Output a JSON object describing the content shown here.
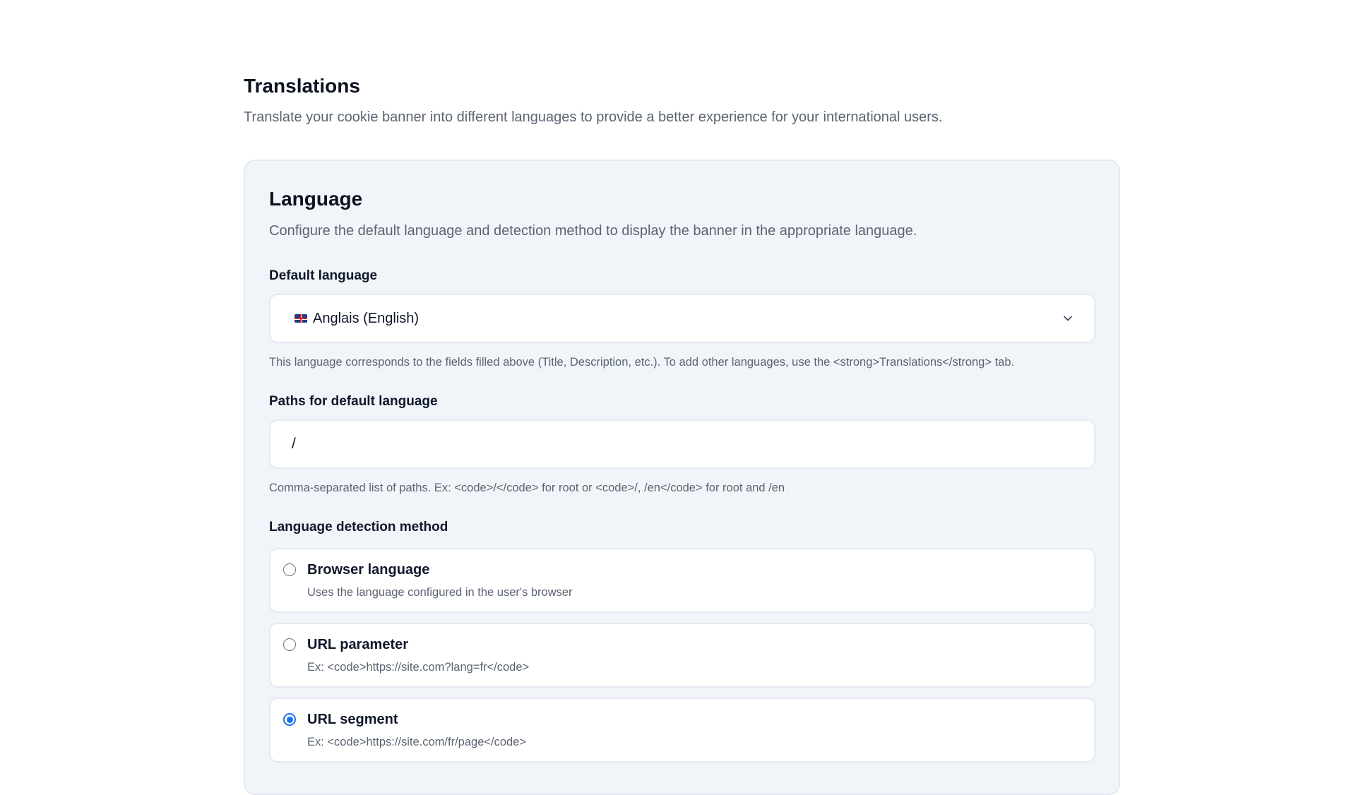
{
  "header": {
    "title": "Translations",
    "subtitle": "Translate your cookie banner into different languages to provide a better experience for your international users."
  },
  "language_card": {
    "title": "Language",
    "subtitle": "Configure the default language and detection method to display the banner in the appropriate language.",
    "default_language": {
      "label": "Default language",
      "selected_value": "Anglais (English)",
      "flag_icon": "uk-flag-icon",
      "help": "This language corresponds to the fields filled above (Title, Description, etc.). To add other languages, use the <strong>Translations</strong> tab."
    },
    "paths": {
      "label": "Paths for default language",
      "value": "/",
      "help": "Comma-separated list of paths. Ex: <code>/</code> for root or <code>/, /en</code> for root and /en"
    },
    "detection": {
      "label": "Language detection method",
      "options": [
        {
          "title": "Browser language",
          "description": "Uses the language configured in the user's browser",
          "checked": false
        },
        {
          "title": "URL parameter",
          "description": "Ex: <code>https://site.com?lang=fr</code>",
          "checked": false
        },
        {
          "title": "URL segment",
          "description": "Ex: <code>https://site.com/fr/page</code>",
          "checked": true
        }
      ]
    }
  },
  "colors": {
    "accent": "#1a73e8",
    "card_background": "#f1f5f9",
    "muted_text": "#5b6472"
  }
}
